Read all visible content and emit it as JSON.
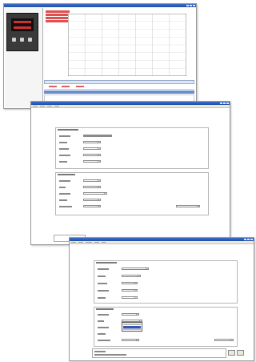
{
  "chart_window": {
    "legend_lines": [
      "",
      "",
      "",
      ""
    ],
    "tick_labels_left": [
      "",
      "",
      "",
      "",
      "",
      "",
      "",
      "",
      ""
    ],
    "tick_labels_right": [
      "",
      "",
      "",
      "",
      "",
      "",
      "",
      "",
      ""
    ],
    "tick_labels_bottom": [
      "",
      "",
      "",
      "",
      "",
      "",
      "",
      ""
    ],
    "table_values": [
      "",
      "",
      "",
      "",
      "",
      ""
    ]
  },
  "device": {
    "display_color": "#d03030"
  },
  "config_window": {
    "menu": [
      "",
      "",
      "",
      "",
      ""
    ],
    "section_1": {
      "title": "",
      "rows": [
        "",
        "",
        "",
        "",
        ""
      ]
    },
    "section_2": {
      "title": "",
      "rows": [
        "",
        "",
        "",
        "",
        ""
      ]
    }
  },
  "front_window": {
    "menu": [
      "",
      "",
      "",
      "",
      ""
    ],
    "section_1": {
      "title": "",
      "rows": [
        "",
        "",
        "",
        "",
        ""
      ]
    },
    "section_2": {
      "title": "",
      "rows": [
        "",
        "",
        "",
        "",
        ""
      ]
    },
    "dropdown_options": [
      "",
      "",
      "",
      ""
    ],
    "status_lines": [
      "",
      ""
    ]
  },
  "colors": {
    "titlebar": "#1d4ea8",
    "highlight": "#3355bb",
    "alarm": "#d42020"
  }
}
